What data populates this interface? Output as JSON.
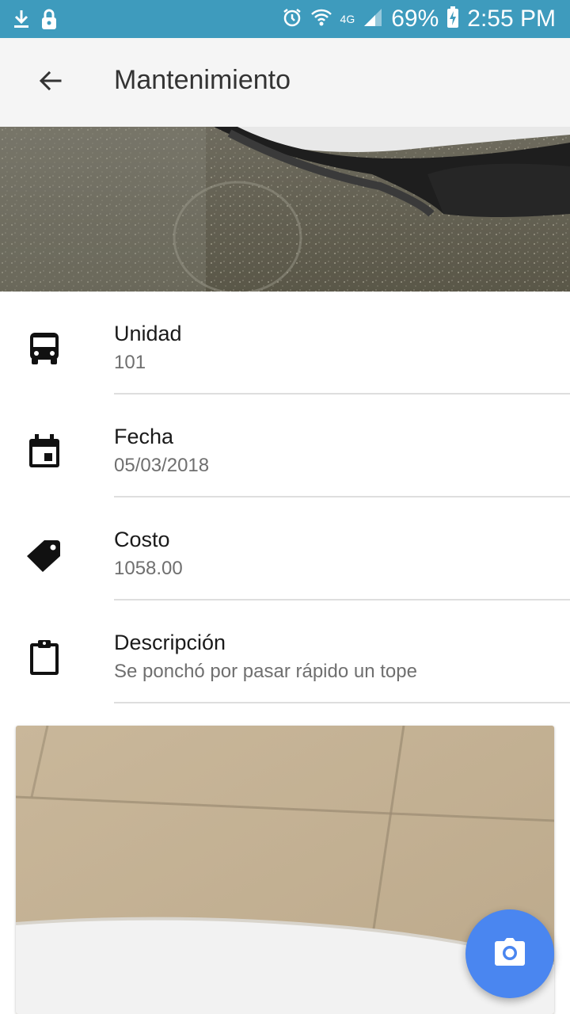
{
  "status_bar": {
    "network": "4G",
    "battery": "69%",
    "time": "2:55 PM"
  },
  "app_bar": {
    "title": "Mantenimiento",
    "back_icon": "arrow-back-icon"
  },
  "details": [
    {
      "icon": "bus-icon",
      "label": "Unidad",
      "value": "101"
    },
    {
      "icon": "calendar-icon",
      "label": "Fecha",
      "value": "05/03/2018"
    },
    {
      "icon": "tag-icon",
      "label": "Costo",
      "value": "1058.00"
    },
    {
      "icon": "clipboard-icon",
      "label": "Descripción",
      "value": "Se ponchó por pasar rápido un tope"
    }
  ],
  "fab": {
    "icon": "camera-icon"
  },
  "colors": {
    "status_bar": "#3e9bbd",
    "app_bar": "#f5f5f5",
    "fab": "#4a86f0"
  }
}
